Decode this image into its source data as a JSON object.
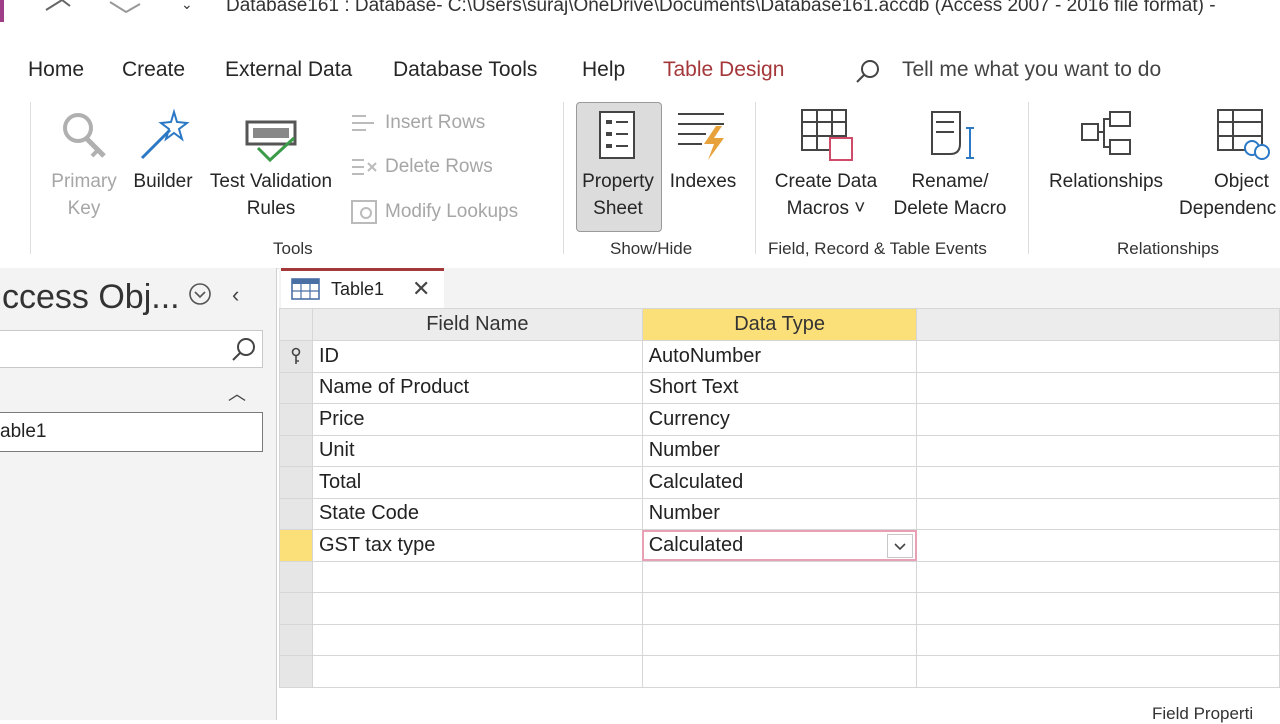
{
  "window": {
    "title": "Database161 : Database- C:\\Users\\suraj\\OneDrive\\Documents\\Database161.accdb (Access 2007 - 2016 file format) -"
  },
  "tabs": [
    "Home",
    "Create",
    "External Data",
    "Database Tools",
    "Help",
    "Table Design"
  ],
  "active_tab": "Table Design",
  "tell_me": "Tell me what you want to do",
  "ribbon": {
    "groups": {
      "tools": "Tools",
      "show_hide": "Show/Hide",
      "field_record_table_events": "Field, Record & Table Events",
      "relationships": "Relationships"
    },
    "buttons": {
      "primary_key": [
        "Primary",
        "Key"
      ],
      "builder": "Builder",
      "test_validation": [
        "Test Validation",
        "Rules"
      ],
      "insert_rows": "Insert Rows",
      "delete_rows": "Delete Rows",
      "modify_lookups": "Modify Lookups",
      "property_sheet": [
        "Property",
        "Sheet"
      ],
      "indexes": "Indexes",
      "create_data_macros": [
        "Create Data",
        "Macros ˅"
      ],
      "rename_delete_macro": [
        "Rename/",
        "Delete Macro"
      ],
      "relationships": "Relationships",
      "object_dependencies": [
        "Object",
        "Dependenc"
      ]
    }
  },
  "nav": {
    "title": "ccess Obj...",
    "items": [
      "able1"
    ]
  },
  "doc_tab": {
    "label": "Table1"
  },
  "grid": {
    "headers": [
      "Field Name",
      "Data Type"
    ],
    "rows": [
      {
        "field": "ID",
        "type": "AutoNumber"
      },
      {
        "field": "Name of Product",
        "type": "Short Text"
      },
      {
        "field": "Price",
        "type": "Currency"
      },
      {
        "field": "Unit",
        "type": "Number"
      },
      {
        "field": "Total",
        "type": "Calculated"
      },
      {
        "field": "State Code",
        "type": "Number"
      },
      {
        "field": "GST tax type",
        "type": "Calculated"
      }
    ],
    "empty_rows": 4
  },
  "field_properties_label": "Field Properti",
  "colors": {
    "accent": "#a4373a",
    "highlight": "#fbe07a",
    "access_purple": "#a03d87"
  },
  "icons": [
    "undo-icon",
    "redo-icon",
    "search-icon",
    "key-icon",
    "wand-icon",
    "validation-icon",
    "property-sheet-icon",
    "indexes-icon",
    "macro-icon",
    "relationships-icon",
    "table-icon",
    "close-icon"
  ]
}
